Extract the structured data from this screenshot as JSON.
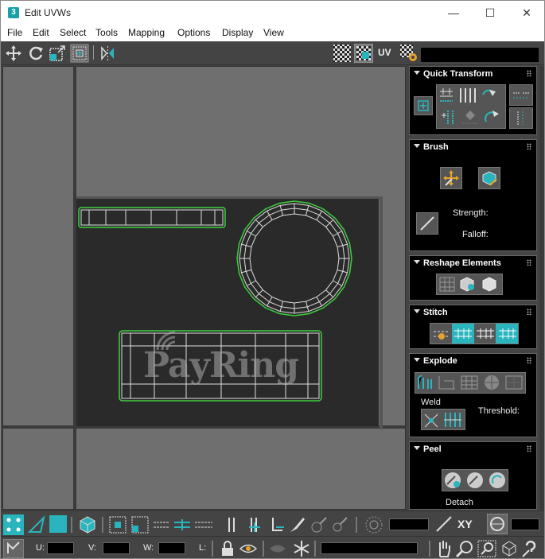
{
  "window": {
    "app_icon_label": "3",
    "title": "Edit UVWs",
    "minimize_glyph": "—",
    "maximize_glyph": "☐",
    "close_glyph": "✕"
  },
  "menu": [
    "File",
    "Edit",
    "Select",
    "Tools",
    "Mapping",
    "Options",
    "Display",
    "View"
  ],
  "toolbar": {
    "uv_label": "UV",
    "icons": [
      "move-icon",
      "rotate-icon",
      "scale-icon",
      "freeform-icon",
      "mirror-icon",
      "checker-icon",
      "checker-toggle-icon",
      "uv-settings-icon"
    ]
  },
  "panel": {
    "quick_transform": {
      "title": "Quick Transform"
    },
    "brush": {
      "title": "Brush",
      "strength_label": "Strength:",
      "falloff_label": "Falloff:"
    },
    "reshape": {
      "title": "Reshape Elements"
    },
    "stitch": {
      "title": "Stitch"
    },
    "explode": {
      "title": "Explode",
      "weld_label": "Weld",
      "threshold_label": "Threshold:"
    },
    "peel": {
      "title": "Peel",
      "detach_label": "Detach"
    }
  },
  "bottom": {
    "xy_label": "XY",
    "u_label": "U:",
    "v_label": "V:",
    "w_label": "W:",
    "l_label": "L:",
    "u_value": "",
    "v_value": "",
    "w_value": "",
    "l_value": ""
  },
  "colors": {
    "accent": "#2ab4bd",
    "uv_selection": "#3ccf3c",
    "background": "#444444",
    "uv_tile": "#2a2a2a"
  }
}
